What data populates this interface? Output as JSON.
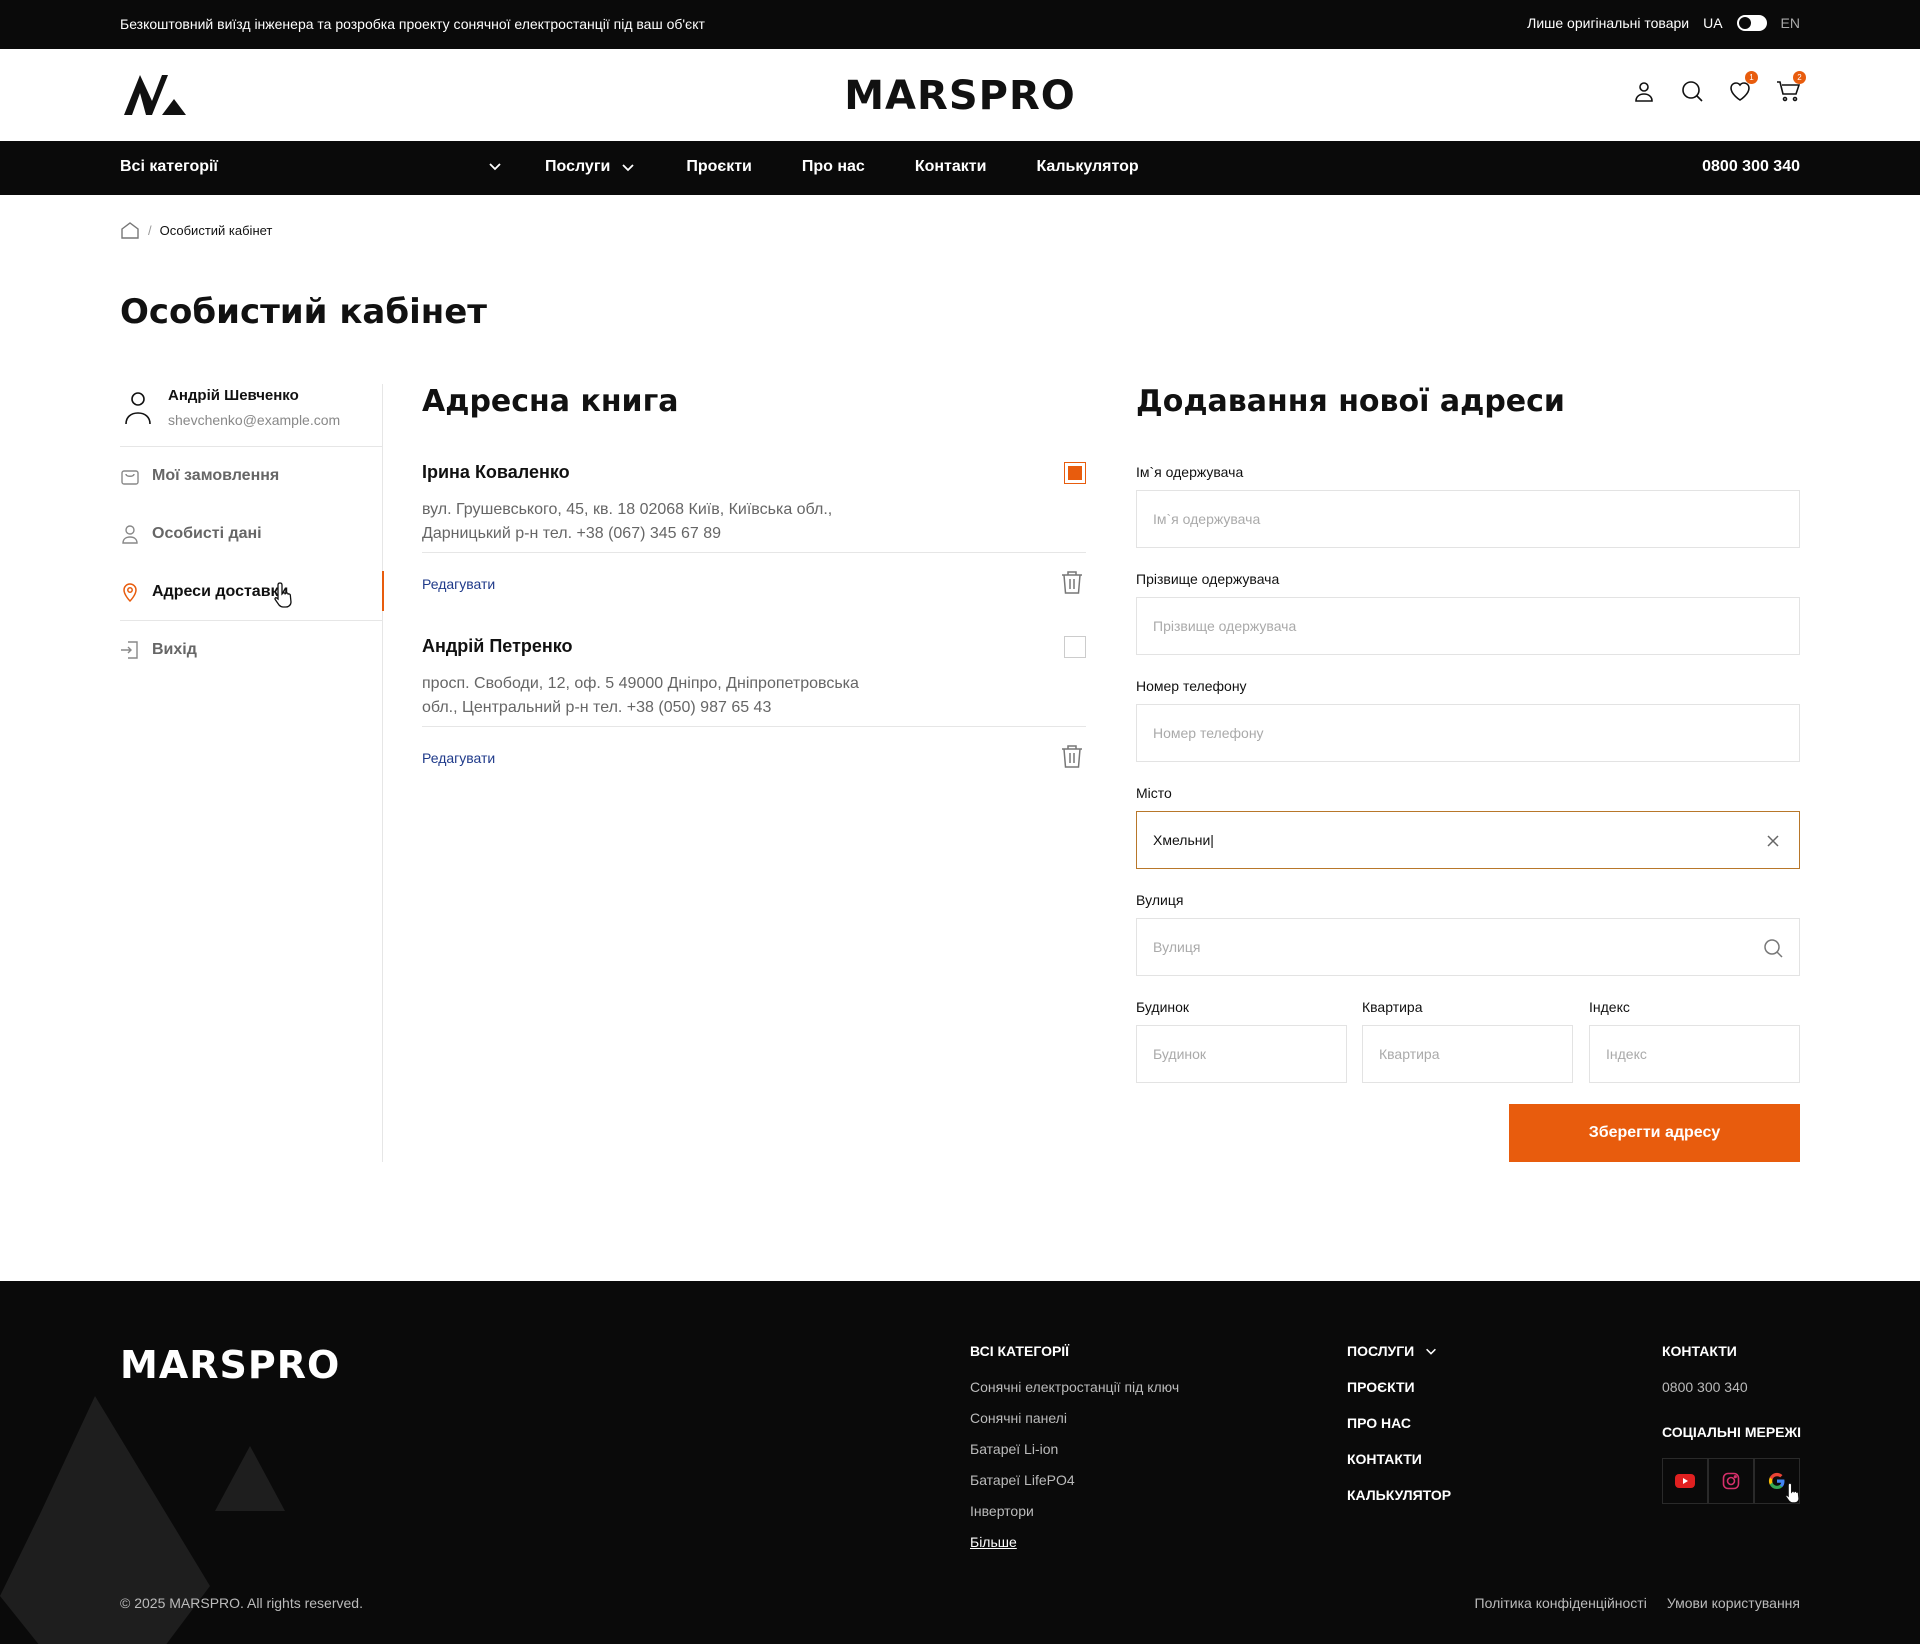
{
  "topbar": {
    "promo": "Безкоштовний виїзд інженера та розробка проекту сонячної електростанції під ваш об'єкт",
    "originals": "Лише оригінальні товари",
    "lang_ua": "UA",
    "lang_en": "EN"
  },
  "header": {
    "brand": "MARSPRO",
    "wishlist_count": "1",
    "cart_count": "2"
  },
  "nav": {
    "all_categories": "Всі категорії",
    "items": [
      "Послуги",
      "Проєкти",
      "Про нас",
      "Контакти",
      "Калькулятор"
    ],
    "phone": "0800 300 340"
  },
  "breadcrumb": {
    "separator": "/",
    "current": "Особистий кабінет"
  },
  "page": {
    "title": "Особистий кабінет"
  },
  "sidebar": {
    "user_name": "Андрій Шевченко",
    "user_email": "shevchenko@example.com",
    "items": [
      {
        "label": "Мої замовлення",
        "icon": "bag-icon"
      },
      {
        "label": "Особисті дані",
        "icon": "user-icon"
      },
      {
        "label": "Адреси доставки",
        "icon": "location-pin-icon",
        "active": true
      },
      {
        "label": "Вихід",
        "icon": "logout-icon"
      }
    ]
  },
  "address_book": {
    "title": "Адресна книга",
    "edit_label": "Редагувати",
    "entries": [
      {
        "name": "Ірина Коваленко",
        "address": "вул. Грушевського, 45, кв. 18 02068 Київ, Київська обл., Дарницький р-н тел. +38 (067) 345 67 89",
        "selected": true
      },
      {
        "name": "Андрій Петренко",
        "address": "просп. Свободи, 12, оф. 5 49000 Дніпро, Дніпропетровська обл., Центральний р-н тел. +38 (050) 987 65 43",
        "selected": false
      }
    ]
  },
  "form": {
    "title": "Додавання нової адреси",
    "first_name": {
      "label": "Ім`я одержувача",
      "placeholder": "Ім`я одержувача"
    },
    "last_name": {
      "label": "Прізвище одержувача",
      "placeholder": "Прізвище одержувача"
    },
    "phone": {
      "label": "Номер телефону",
      "placeholder": "Номер телефону"
    },
    "city": {
      "label": "Місто",
      "value": "Хмельни|"
    },
    "street": {
      "label": "Вулиця",
      "placeholder": "Вулиця"
    },
    "house": {
      "label": "Будинок",
      "placeholder": "Будинок"
    },
    "apartment": {
      "label": "Квартира",
      "placeholder": "Квартира"
    },
    "zip": {
      "label": "Індекс",
      "placeholder": "Індекс"
    },
    "save_label": "Зберегти адресу"
  },
  "footer": {
    "brand": "MARSPRO",
    "categories_title": "ВСІ КАТЕГОРІЇ",
    "categories": [
      "Сонячні електростанції під ключ",
      "Сонячні панелі",
      "Батареї Li-ion",
      "Батареї LifePO4",
      "Інвертори"
    ],
    "more": "Більше",
    "menu": [
      "ПОСЛУГИ",
      "ПРОЄКТИ",
      "ПРО НАС",
      "КОНТАКТИ",
      "КАЛЬКУЛЯТОР"
    ],
    "contacts_title": "КОНТАКТИ",
    "contacts_phone": "0800 300 340",
    "social_title": "СОЦІАЛЬНІ МЕРЕЖІ",
    "copyright": "© 2025 MARSPRO. All rights reserved.",
    "privacy": "Політика конфіденційності",
    "terms": "Умови користування"
  },
  "colors": {
    "accent": "#e85c0d",
    "dark": "#0a0a0a",
    "link": "#1f3a8a"
  }
}
